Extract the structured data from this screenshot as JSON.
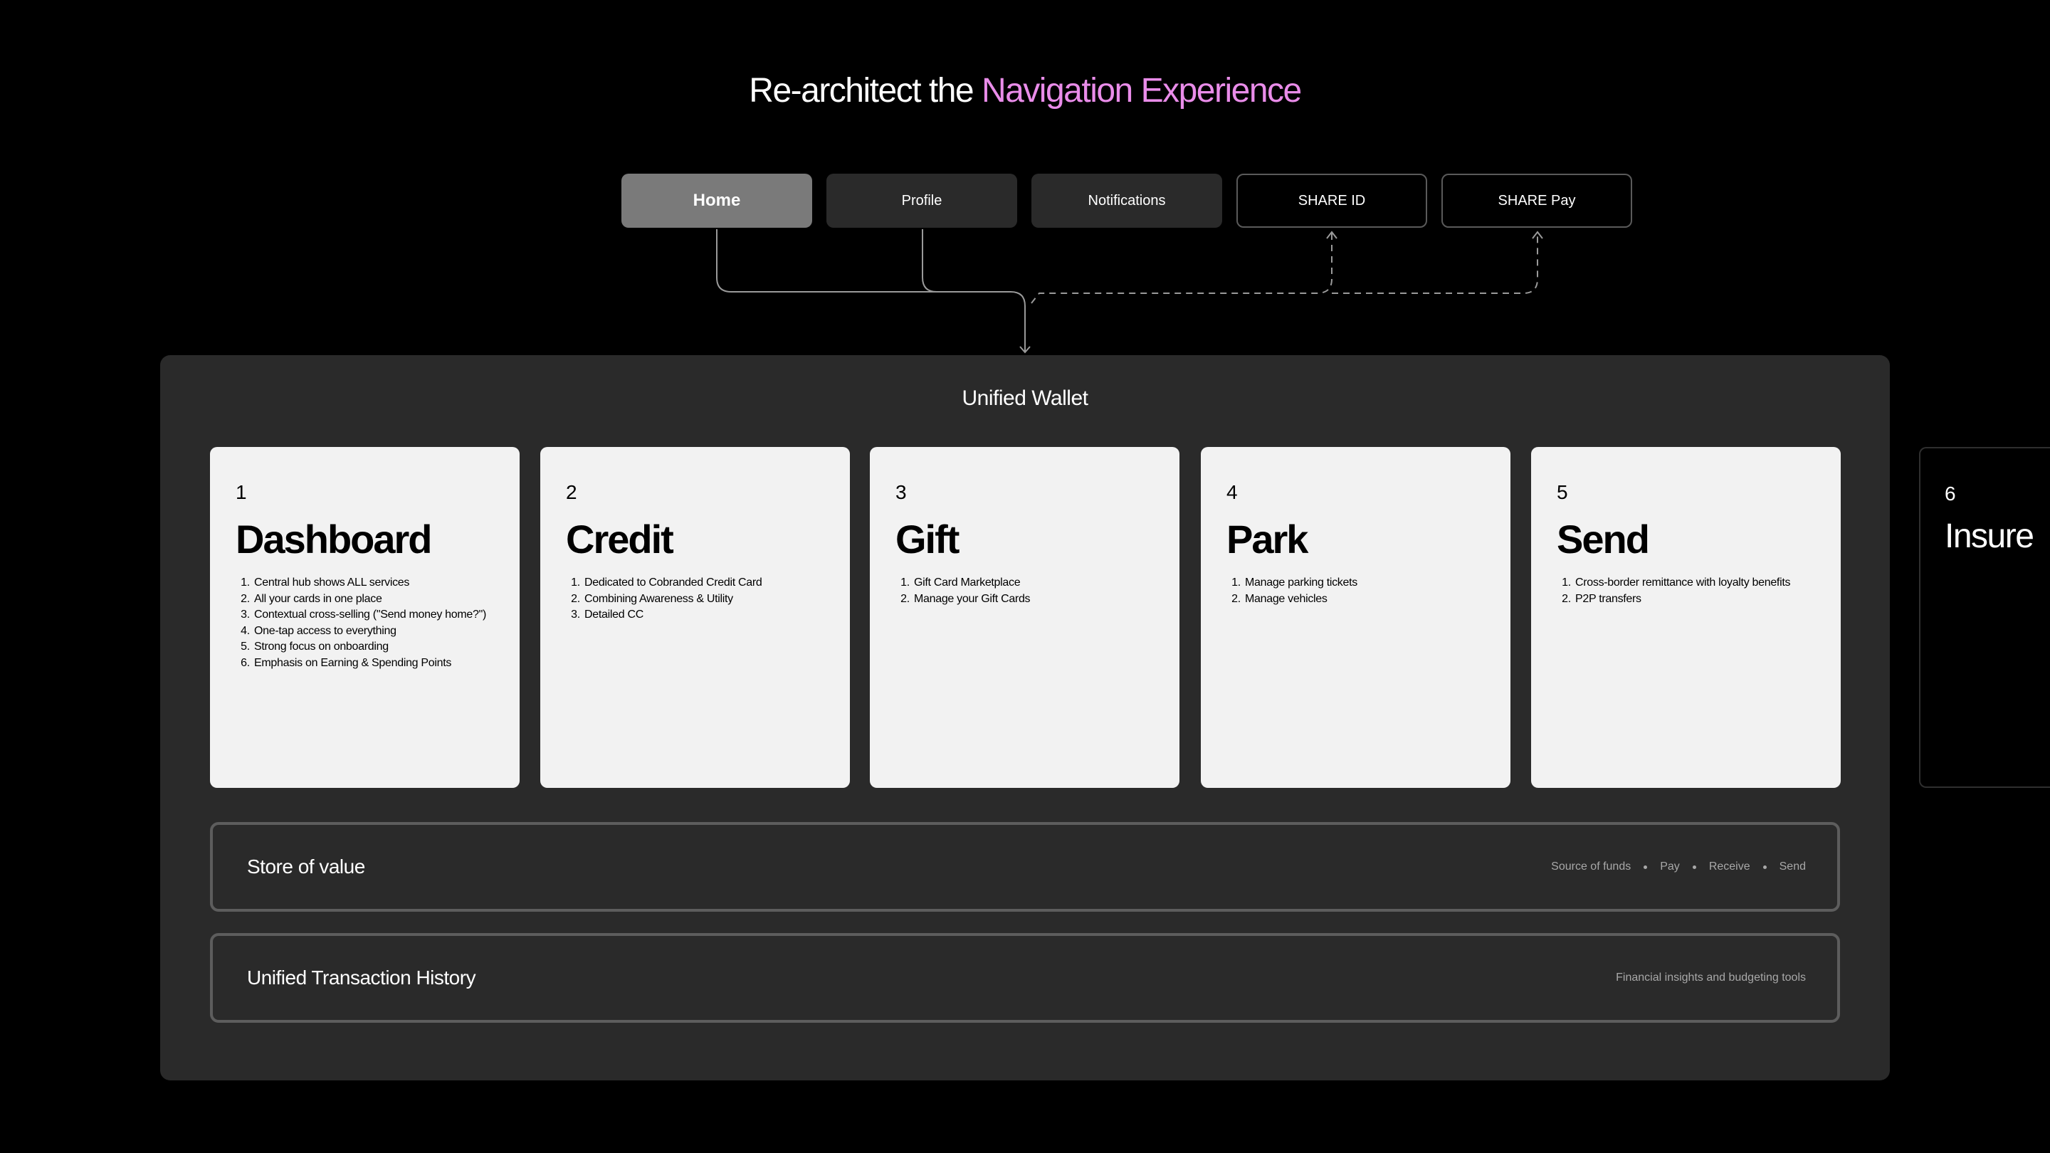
{
  "headline": {
    "prefix": "Re-architect the",
    "accent": "Navigation Experience",
    "accent_color": "#e98ce9"
  },
  "nav_tabs": [
    {
      "label": "Home",
      "style": "active"
    },
    {
      "label": "Profile",
      "style": "filled"
    },
    {
      "label": "Notifications",
      "style": "filled"
    },
    {
      "label": "SHARE ID",
      "style": "outlined"
    },
    {
      "label": "SHARE Pay",
      "style": "outlined"
    }
  ],
  "connectors": {
    "solid": [
      "Home",
      "Profile"
    ],
    "dashed": [
      "SHARE ID",
      "SHARE Pay"
    ],
    "target": "Unified Wallet"
  },
  "wallet": {
    "title": "Unified Wallet",
    "cards": [
      {
        "number": "1",
        "title": "Dashboard",
        "items": [
          "Central hub shows ALL services",
          "All your cards in one place",
          "Contextual cross-selling (\"Send money home?\")",
          "One-tap access to everything",
          "Strong focus on onboarding",
          "Emphasis on Earning & Spending Points"
        ]
      },
      {
        "number": "2",
        "title": "Credit",
        "items": [
          "Dedicated to Cobranded Credit Card",
          "Combining Awareness & Utility",
          "Detailed CC"
        ]
      },
      {
        "number": "3",
        "title": "Gift",
        "items": [
          "Gift Card Marketplace",
          "Manage your Gift Cards"
        ]
      },
      {
        "number": "4",
        "title": "Park",
        "items": [
          "Manage parking tickets",
          "Manage vehicles"
        ]
      },
      {
        "number": "5",
        "title": "Send",
        "items": [
          "Cross-border remittance with loyalty benefits",
          "P2P transfers"
        ]
      },
      {
        "number": "6",
        "title": "Insure",
        "items": []
      }
    ],
    "store_of_value": {
      "title": "Store of value",
      "tags": [
        "Source of funds",
        "Pay",
        "Receive",
        "Send"
      ]
    },
    "transaction_history": {
      "title": "Unified Transaction History",
      "note": "Financial insights and budgeting tools"
    }
  }
}
